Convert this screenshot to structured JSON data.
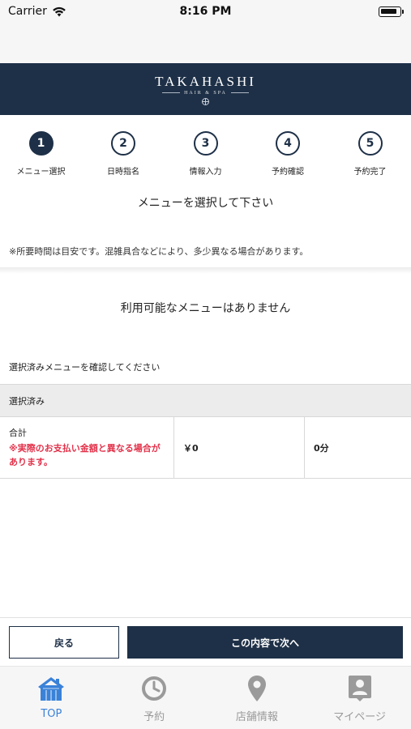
{
  "status_bar": {
    "carrier": "Carrier",
    "time": "8:16 PM"
  },
  "brand": {
    "title": "TAKAHASHI",
    "subtitle": "HAIR & SPA"
  },
  "steps": [
    {
      "number": "1",
      "label": "メニュー選択"
    },
    {
      "number": "2",
      "label": "日時指名"
    },
    {
      "number": "3",
      "label": "情報入力"
    },
    {
      "number": "4",
      "label": "予約確認"
    },
    {
      "number": "5",
      "label": "予約完了"
    }
  ],
  "active_step": 1,
  "main": {
    "title": "メニューを選択して下さい",
    "note": "※所要時間は目安です。混雑具合などにより、多少異なる場合があります。",
    "empty_message": "利用可能なメニューはありません",
    "confirm_label": "選択済みメニューを確認してください"
  },
  "selected": {
    "header": "選択済み",
    "total_label": "合計",
    "warning": "※実際のお支払い金額と異なる場合があります。",
    "price": "￥0",
    "duration": "0分"
  },
  "actions": {
    "back": "戻る",
    "next": "この内容で次へ"
  },
  "tabs": [
    {
      "label": "TOP",
      "icon": "home-icon"
    },
    {
      "label": "予約",
      "icon": "clock-icon"
    },
    {
      "label": "店舗情報",
      "icon": "location-pin-icon"
    },
    {
      "label": "マイページ",
      "icon": "person-badge-icon"
    }
  ],
  "colors": {
    "navy": "#1e3047",
    "accent_blue": "#3a82d8",
    "warning_red": "#e2324a",
    "tab_gray": "#9a9a9a"
  }
}
